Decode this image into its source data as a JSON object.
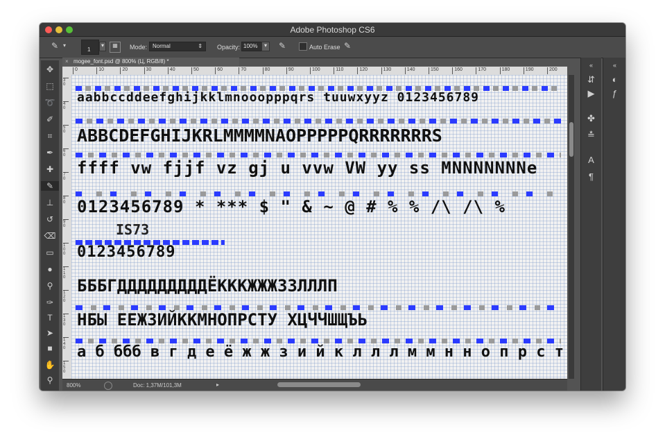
{
  "window": {
    "title": "Adobe Photoshop CS6"
  },
  "options_bar": {
    "brush_size": "1",
    "mode_label": "Mode:",
    "mode_value": "Normal",
    "opacity_label": "Opacity:",
    "opacity_value": "100%",
    "auto_erase_label": "Auto Erase"
  },
  "document": {
    "tab_title": "mogee_font.psd @ 800% (Ц, RGB/8) *"
  },
  "ruler": {
    "top_ticks": [
      "0",
      "10",
      "20",
      "30",
      "40",
      "50",
      "60",
      "70",
      "80",
      "90",
      "100",
      "110",
      "120",
      "130",
      "140",
      "150",
      "160",
      "170",
      "180",
      "190",
      "200"
    ],
    "left_ticks": [
      "3 0",
      "4 0",
      "5 0",
      "6 0",
      "7 0",
      "8 0",
      "9 0",
      "1 0 0",
      "1 1 0",
      "1 2 0",
      "1 3 0",
      "1 4 0",
      "1 5 0"
    ]
  },
  "canvas": {
    "rows": [
      "aabbccddeefghijkklmnooopppqrs tuuwxyyz 0123456789",
      "ABBCDEFGHIJKRLMMMMNAOPPPPPQRRRRRRRS",
      "ffff vw fjjf vz gj u vvw VW yy ss MNNNNNNNe",
      "0123456789 * *** $ \" & ~ @ # % % /\\ /\\ %",
      "IS73",
      "0123456789",
      "БББГДДДДДДДДДЁКККЖЖЖЗЗЛЛЛП",
      "НБЫ  ЕЕЖЗИЙККМНОПРСТУ   ХЦЧЧШЩЪЬ",
      "а б ббб в г д е ё ж ж з и й к л л л м м н н о п р с т у ф х ц"
    ]
  },
  "status": {
    "zoom": "800%",
    "doc_info": "Doc: 1,37M/101,3M"
  }
}
